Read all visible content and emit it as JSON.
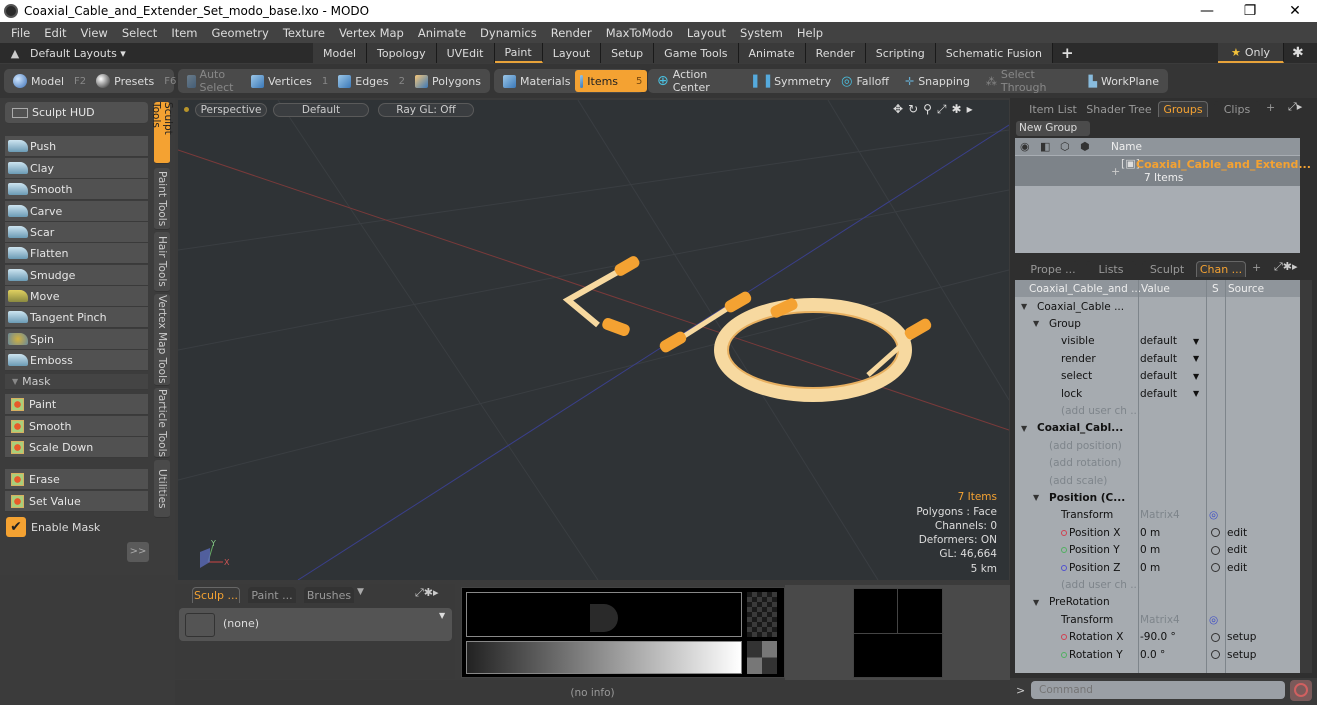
{
  "window": {
    "title": "Coaxial_Cable_and_Extender_Set_modo_base.lxo - MODO",
    "controls": [
      "minimize",
      "restore",
      "close"
    ]
  },
  "menubar": [
    "File",
    "Edit",
    "View",
    "Select",
    "Item",
    "Geometry",
    "Texture",
    "Vertex Map",
    "Animate",
    "Dynamics",
    "Render",
    "MaxToModo",
    "Layout",
    "System",
    "Help"
  ],
  "layoutbar": {
    "layouts_label": "Default Layouts ▾",
    "tabs": [
      "Model",
      "Topology",
      "UVEdit",
      "Paint",
      "Layout",
      "Setup",
      "Game Tools",
      "Animate",
      "Render",
      "Scripting",
      "Schematic Fusion"
    ],
    "active_tab": "Paint",
    "add_label": "+",
    "only_label": "Only"
  },
  "toolbar": {
    "model": {
      "label": "Model",
      "key": "F2"
    },
    "presets": {
      "label": "Presets",
      "key": "F6"
    },
    "auto_select": "Auto Select",
    "vertices": {
      "label": "Vertices",
      "key": "1"
    },
    "edges": {
      "label": "Edges",
      "key": "2"
    },
    "polygons": {
      "label": "Polygons"
    },
    "materials": {
      "label": "Materials"
    },
    "items": {
      "label": "Items",
      "key": "5"
    },
    "action_center": "Action Center",
    "symmetry": "Symmetry",
    "falloff": "Falloff",
    "snapping": "Snapping",
    "select_through": "Select Through",
    "workplane": "WorkPlane"
  },
  "leftpanel": {
    "sculpt_hud": "Sculpt HUD",
    "tools": [
      "Push",
      "Clay",
      "Smooth",
      "Carve",
      "Scar",
      "Flatten",
      "Smudge",
      "Move",
      "Tangent Pinch",
      "Spin",
      "Emboss"
    ],
    "mask_header": "Mask",
    "mask_tools": [
      "Paint",
      "Smooth",
      "Scale Down"
    ],
    "mask_tools2": [
      "Erase",
      "Set Value"
    ],
    "enable_mask": "Enable Mask",
    "enable_mask_checked": true,
    "expand_label": ">>",
    "vertical_tabs": [
      "Sculpt Tools",
      "Paint Tools",
      "Hair Tools",
      "Vertex Map Tools",
      "Particle Tools",
      "Utilities"
    ],
    "active_vertical_tab": "Sculpt Tools"
  },
  "viewport": {
    "view_mode": "Perspective",
    "shading": "Default",
    "raygl": "Ray GL: Off",
    "stats": {
      "items": "7 Items",
      "polygons": "Polygons : Face",
      "channels": "Channels: 0",
      "deformers": "Deformers: ON",
      "gl": "GL: 46,664",
      "scale": "5 km"
    },
    "axis_labels": {
      "x": "X",
      "y": "Y"
    }
  },
  "groups_panel": {
    "tabs": [
      "Item List",
      "Shader Tree",
      "Groups",
      "Clips"
    ],
    "active_tab": "Groups",
    "new_group": "New Group",
    "column_name": "Name",
    "group_name": "Coaxial_Cable_and_Extend...",
    "group_count": "7 Items"
  },
  "channels_panel": {
    "tabs": [
      "Prope ...",
      "Lists",
      "Sculpt",
      "Chan ..."
    ],
    "active_tab": "Chan ...",
    "columns": [
      "Coaxial_Cable_and ...",
      "Value",
      "S",
      "Source"
    ],
    "rows": [
      {
        "name": "Coaxial_Cable ...",
        "indent": 1,
        "type": "item"
      },
      {
        "name": "Group",
        "indent": 2,
        "type": "item"
      },
      {
        "name": "visible",
        "value": "default",
        "dropdown": true,
        "indent": 3
      },
      {
        "name": "render",
        "value": "default",
        "dropdown": true,
        "indent": 3
      },
      {
        "name": "select",
        "value": "default",
        "dropdown": true,
        "indent": 3
      },
      {
        "name": "lock",
        "value": "default",
        "dropdown": true,
        "indent": 3
      },
      {
        "name": "(add user ch ...",
        "dim": true,
        "indent": 3
      },
      {
        "name": "Coaxial_Cabl...",
        "indent": 1,
        "type": "locator",
        "bold": true
      },
      {
        "name": "(add position)",
        "dim": true,
        "indent": 2
      },
      {
        "name": "(add rotation)",
        "dim": true,
        "indent": 2
      },
      {
        "name": "(add scale)",
        "dim": true,
        "indent": 2
      },
      {
        "name": "Position (C...",
        "indent": 2,
        "bold": true
      },
      {
        "name": "Transform",
        "value": "Matrix4",
        "value_dim": true,
        "gear": true,
        "indent": 3
      },
      {
        "name": "Position X",
        "value": "0 m",
        "source": "edit",
        "dot": "#d04050",
        "indent": 3
      },
      {
        "name": "Position Y",
        "value": "0 m",
        "source": "edit",
        "dot": "#50b060",
        "indent": 3
      },
      {
        "name": "Position Z",
        "value": "0 m",
        "source": "edit",
        "dot": "#5050d0",
        "indent": 3
      },
      {
        "name": "(add user ch ...",
        "dim": true,
        "indent": 3
      },
      {
        "name": "PreRotation",
        "indent": 2
      },
      {
        "name": "Transform",
        "value": "Matrix4",
        "value_dim": true,
        "gear": true,
        "indent": 3
      },
      {
        "name": "Rotation X",
        "value": "-90.0 °",
        "source": "setup",
        "dot": "#d04050",
        "indent": 3
      },
      {
        "name": "Rotation Y",
        "value": "0.0 °",
        "source": "setup",
        "dot": "#50b060",
        "indent": 3
      }
    ]
  },
  "bottom_panel": {
    "tabs": [
      "Sculp ...",
      "Paint ...",
      "Brushes"
    ],
    "active_tab": "Sculp ...",
    "brush_value": "(none)"
  },
  "status": {
    "info": "(no info)",
    "command_placeholder": "Command"
  },
  "colors": {
    "accent": "#f4a232",
    "selection_orange": "#f4a232",
    "viewport_bg": "#2f3336"
  }
}
